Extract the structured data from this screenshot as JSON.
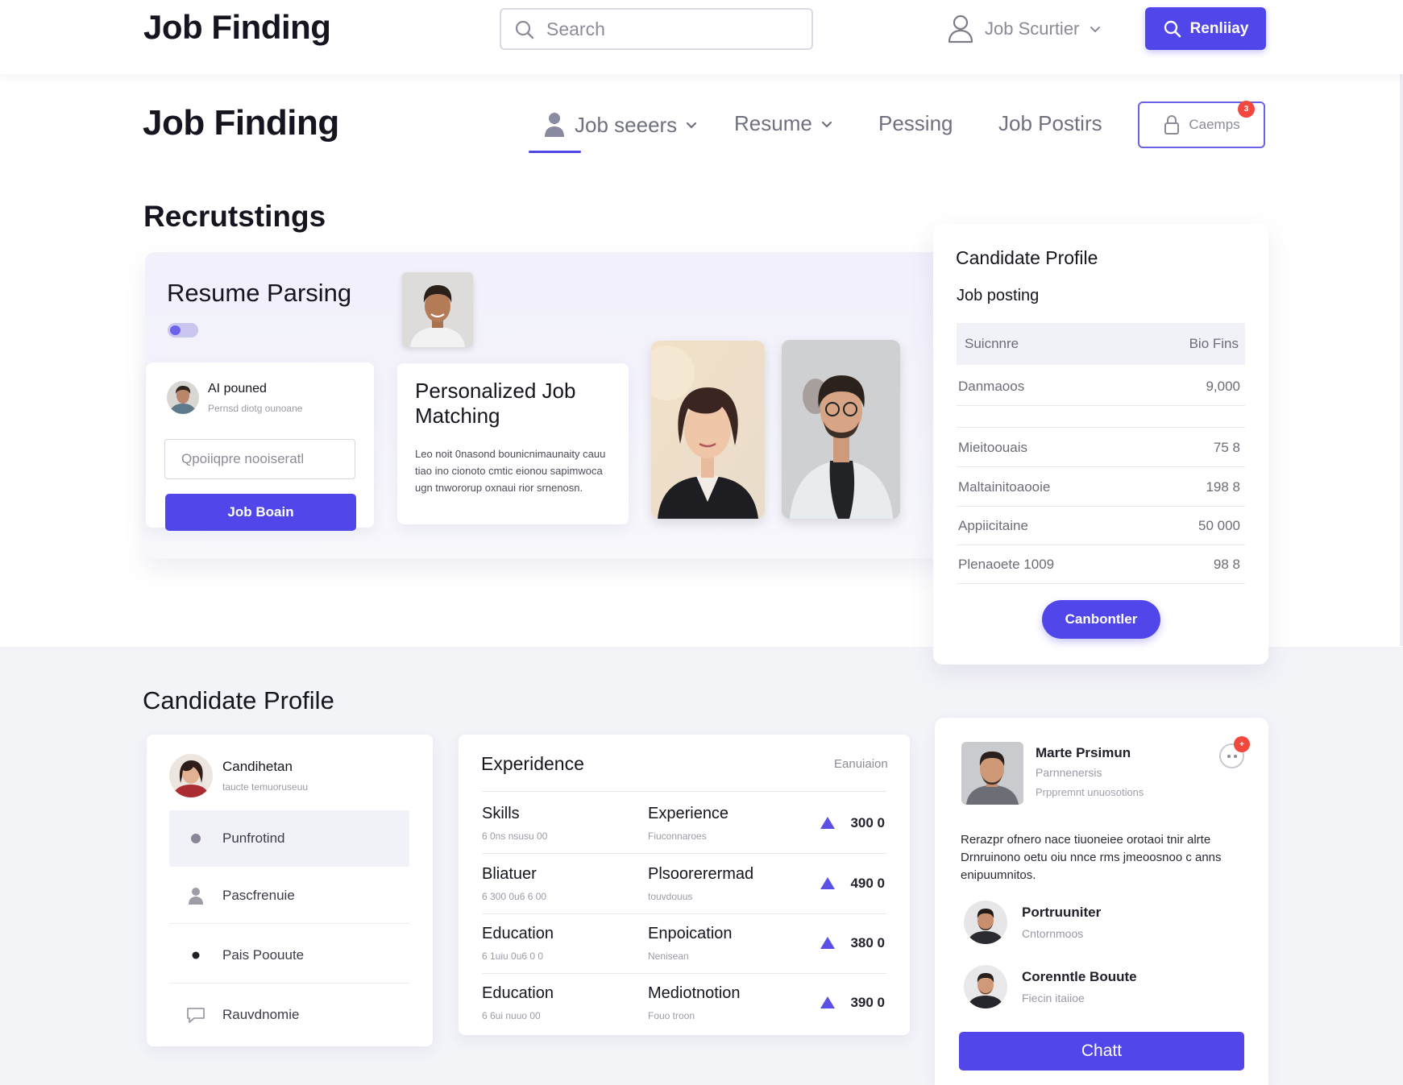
{
  "topbar": {
    "brand": "Job Finding",
    "search_placeholder": "Search",
    "user_label": "Job Scurtier",
    "primary_button": "Renliiay"
  },
  "subnav": {
    "brand": "Job Finding",
    "items": [
      {
        "label": "Job seeers",
        "has_caret": true,
        "active": true
      },
      {
        "label": "Resume",
        "has_caret": true
      },
      {
        "label": "Pessing"
      },
      {
        "label": "Job Postirs"
      }
    ],
    "outline_button": "Caemps",
    "badge": "3"
  },
  "recruitings": {
    "title": "Recrutstings",
    "resume_parsing": {
      "title": "Resume Parsing",
      "toggle_on": true
    },
    "ai_card": {
      "title": "AI pouned",
      "subtitle": "Pernsd diotg ounoane",
      "input_placeholder": "Qpoiiqpre nooiseratl",
      "button": "Job Boain"
    },
    "match_card": {
      "title": "Personalized Job Matching",
      "body": "Leo noit 0nasond bounicnimaunaity cauu tiao ino cionoto cmtic eionou sapimwoca ugn tnwororup oxnaui rior srnenosn."
    }
  },
  "profile_card": {
    "title": "Candidate Profile",
    "subtitle": "Job posting",
    "header": {
      "left": "Suicnnre",
      "right": "Bio Fins"
    },
    "rows": [
      {
        "label": "Danmaoos",
        "value": "9,000"
      },
      {
        "label": "",
        "value": ""
      },
      {
        "label": "Mieitoouais",
        "value": "75 8"
      },
      {
        "label": "Maltainitoaooie",
        "value": "198 8"
      },
      {
        "label": "Appiicitaine",
        "value": "50 000"
      },
      {
        "label": "Plenaoete 1009",
        "value": "98 8"
      }
    ],
    "button": "Canbontler"
  },
  "candidate_section": {
    "title": "Candidate Profile",
    "sidebar": {
      "name": "Candihetan",
      "subtitle": "taucte temuoruseuu",
      "items": [
        {
          "label": "Punfrotind",
          "icon": "dot-icon"
        },
        {
          "label": "Pascfrenuie",
          "icon": "user-icon"
        },
        {
          "label": "Pais Poouute",
          "icon": "bullet-icon"
        },
        {
          "label": "Rauvdnomie",
          "icon": "chat-icon"
        }
      ]
    },
    "experience": {
      "title": "Experidence",
      "link": "Eanuiaion",
      "rows": [
        {
          "left": "Skills",
          "left_sub": "6 0ns nsusu 00",
          "mid": "Experience",
          "mid_sub": "Fiuconnaroes",
          "value": "300 0"
        },
        {
          "left": "Bliatuer",
          "left_sub": "6 300 0u6 6 00",
          "mid": "Plsoorerermad",
          "mid_sub": "touvdouus",
          "value": "490 0"
        },
        {
          "left": "Education",
          "left_sub": "6 1uiu 0u6 0 0",
          "mid": "Enpoication",
          "mid_sub": "Nenisean",
          "value": "380 0"
        },
        {
          "left": "Education",
          "left_sub": "6 6ui nuuo 00",
          "mid": "Mediotnotion",
          "mid_sub": "Fouo troon",
          "value": "390 0"
        }
      ]
    },
    "contact": {
      "name": "Marte Prsimun",
      "role": "Parnnenersis",
      "meta": "Prppremnt unuosotions",
      "badge": "+",
      "body": "Rerazpr ofnero nace tiuoneiee orotaoi tnir alrte Drnruinono oetu oiu nnce rms jmeoosnoo c anns enipuumnitos.",
      "people": [
        {
          "name": "Portruuniter",
          "sub": "Cntornmoos"
        },
        {
          "name": "Corenntle Bouute",
          "sub": "Fiecin itaiioe"
        }
      ],
      "button": "Chatt"
    }
  },
  "colors": {
    "accent": "#5146ea",
    "badge": "#f2483d",
    "text": "#15151f",
    "muted": "#8a8b97",
    "panel": "#f3f4f8"
  }
}
